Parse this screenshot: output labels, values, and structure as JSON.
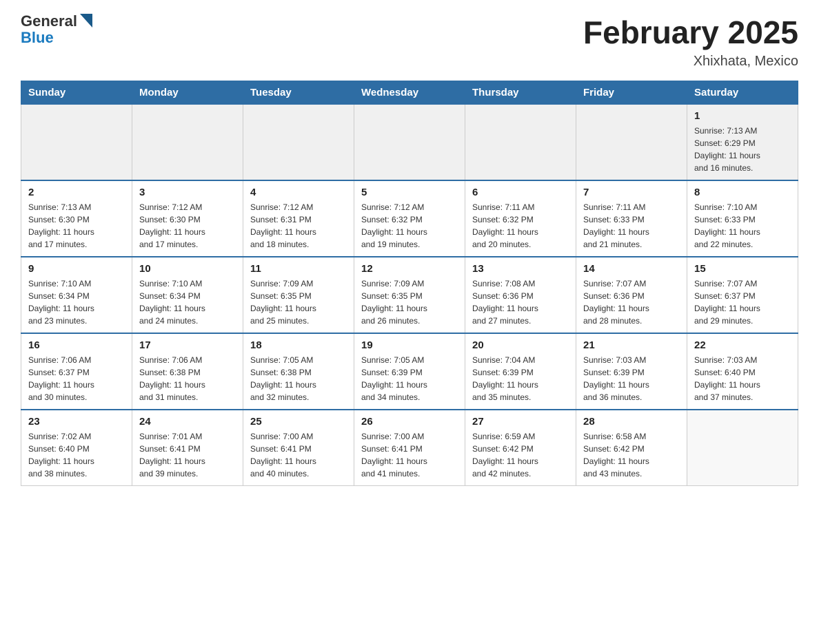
{
  "logo": {
    "text1": "General",
    "text2": "Blue"
  },
  "title": "February 2025",
  "subtitle": "Xhixhata, Mexico",
  "days_of_week": [
    "Sunday",
    "Monday",
    "Tuesday",
    "Wednesday",
    "Thursday",
    "Friday",
    "Saturday"
  ],
  "weeks": [
    [
      {
        "day": "",
        "info": ""
      },
      {
        "day": "",
        "info": ""
      },
      {
        "day": "",
        "info": ""
      },
      {
        "day": "",
        "info": ""
      },
      {
        "day": "",
        "info": ""
      },
      {
        "day": "",
        "info": ""
      },
      {
        "day": "1",
        "info": "Sunrise: 7:13 AM\nSunset: 6:29 PM\nDaylight: 11 hours\nand 16 minutes."
      }
    ],
    [
      {
        "day": "2",
        "info": "Sunrise: 7:13 AM\nSunset: 6:30 PM\nDaylight: 11 hours\nand 17 minutes."
      },
      {
        "day": "3",
        "info": "Sunrise: 7:12 AM\nSunset: 6:30 PM\nDaylight: 11 hours\nand 17 minutes."
      },
      {
        "day": "4",
        "info": "Sunrise: 7:12 AM\nSunset: 6:31 PM\nDaylight: 11 hours\nand 18 minutes."
      },
      {
        "day": "5",
        "info": "Sunrise: 7:12 AM\nSunset: 6:32 PM\nDaylight: 11 hours\nand 19 minutes."
      },
      {
        "day": "6",
        "info": "Sunrise: 7:11 AM\nSunset: 6:32 PM\nDaylight: 11 hours\nand 20 minutes."
      },
      {
        "day": "7",
        "info": "Sunrise: 7:11 AM\nSunset: 6:33 PM\nDaylight: 11 hours\nand 21 minutes."
      },
      {
        "day": "8",
        "info": "Sunrise: 7:10 AM\nSunset: 6:33 PM\nDaylight: 11 hours\nand 22 minutes."
      }
    ],
    [
      {
        "day": "9",
        "info": "Sunrise: 7:10 AM\nSunset: 6:34 PM\nDaylight: 11 hours\nand 23 minutes."
      },
      {
        "day": "10",
        "info": "Sunrise: 7:10 AM\nSunset: 6:34 PM\nDaylight: 11 hours\nand 24 minutes."
      },
      {
        "day": "11",
        "info": "Sunrise: 7:09 AM\nSunset: 6:35 PM\nDaylight: 11 hours\nand 25 minutes."
      },
      {
        "day": "12",
        "info": "Sunrise: 7:09 AM\nSunset: 6:35 PM\nDaylight: 11 hours\nand 26 minutes."
      },
      {
        "day": "13",
        "info": "Sunrise: 7:08 AM\nSunset: 6:36 PM\nDaylight: 11 hours\nand 27 minutes."
      },
      {
        "day": "14",
        "info": "Sunrise: 7:07 AM\nSunset: 6:36 PM\nDaylight: 11 hours\nand 28 minutes."
      },
      {
        "day": "15",
        "info": "Sunrise: 7:07 AM\nSunset: 6:37 PM\nDaylight: 11 hours\nand 29 minutes."
      }
    ],
    [
      {
        "day": "16",
        "info": "Sunrise: 7:06 AM\nSunset: 6:37 PM\nDaylight: 11 hours\nand 30 minutes."
      },
      {
        "day": "17",
        "info": "Sunrise: 7:06 AM\nSunset: 6:38 PM\nDaylight: 11 hours\nand 31 minutes."
      },
      {
        "day": "18",
        "info": "Sunrise: 7:05 AM\nSunset: 6:38 PM\nDaylight: 11 hours\nand 32 minutes."
      },
      {
        "day": "19",
        "info": "Sunrise: 7:05 AM\nSunset: 6:39 PM\nDaylight: 11 hours\nand 34 minutes."
      },
      {
        "day": "20",
        "info": "Sunrise: 7:04 AM\nSunset: 6:39 PM\nDaylight: 11 hours\nand 35 minutes."
      },
      {
        "day": "21",
        "info": "Sunrise: 7:03 AM\nSunset: 6:39 PM\nDaylight: 11 hours\nand 36 minutes."
      },
      {
        "day": "22",
        "info": "Sunrise: 7:03 AM\nSunset: 6:40 PM\nDaylight: 11 hours\nand 37 minutes."
      }
    ],
    [
      {
        "day": "23",
        "info": "Sunrise: 7:02 AM\nSunset: 6:40 PM\nDaylight: 11 hours\nand 38 minutes."
      },
      {
        "day": "24",
        "info": "Sunrise: 7:01 AM\nSunset: 6:41 PM\nDaylight: 11 hours\nand 39 minutes."
      },
      {
        "day": "25",
        "info": "Sunrise: 7:00 AM\nSunset: 6:41 PM\nDaylight: 11 hours\nand 40 minutes."
      },
      {
        "day": "26",
        "info": "Sunrise: 7:00 AM\nSunset: 6:41 PM\nDaylight: 11 hours\nand 41 minutes."
      },
      {
        "day": "27",
        "info": "Sunrise: 6:59 AM\nSunset: 6:42 PM\nDaylight: 11 hours\nand 42 minutes."
      },
      {
        "day": "28",
        "info": "Sunrise: 6:58 AM\nSunset: 6:42 PM\nDaylight: 11 hours\nand 43 minutes."
      },
      {
        "day": "",
        "info": ""
      }
    ]
  ]
}
